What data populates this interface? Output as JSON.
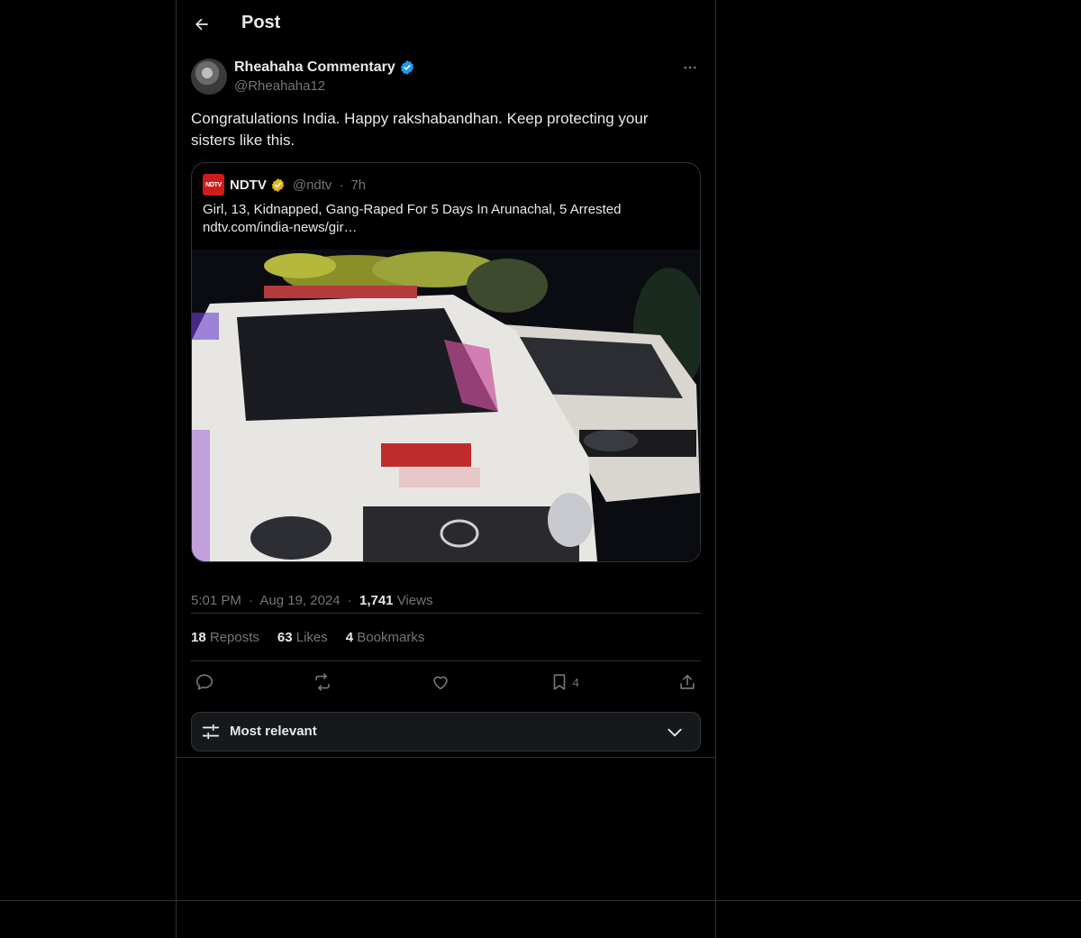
{
  "header": {
    "title": "Post"
  },
  "post": {
    "author": {
      "display_name": "Rheahaha Commentary",
      "handle": "@Rheahaha12"
    },
    "text": "Congratulations India. Happy rakshabandhan. Keep protecting your sisters like this.",
    "quoted": {
      "logo_text": "NDTV",
      "name": "NDTV",
      "handle": "@ndtv",
      "separator": "·",
      "age": "7h",
      "headline": "Girl, 13, Kidnapped, Gang-Raped For 5 Days In Arunachal, 5 Arrested",
      "link": "ndtv.com/india-news/gir…"
    },
    "meta": {
      "time": "5:01 PM",
      "date": "Aug 19, 2024",
      "dot": "·",
      "views_count": "1,741",
      "views_label": "Views"
    },
    "stats": {
      "reposts_count": "18",
      "reposts_label": "Reposts",
      "likes_count": "63",
      "likes_label": "Likes",
      "bookmarks_count": "4",
      "bookmarks_label": "Bookmarks"
    },
    "actions": {
      "bookmark_count": "4"
    }
  },
  "replies": {
    "sort_label": "Most relevant"
  },
  "colors": {
    "background": "#000000",
    "border": "#2f3336",
    "muted": "#71767b",
    "text": "#e7e9ea",
    "verified_blue": "#1d9bf0",
    "verified_gold": "#e2b719",
    "ndtv_red": "#d01b1b"
  },
  "icons": [
    "back-arrow-icon",
    "verified-badge-icon",
    "more-dots-icon",
    "reply-icon",
    "repost-icon",
    "like-icon",
    "bookmark-icon",
    "share-icon",
    "sort-sliders-icon",
    "chevron-down-icon"
  ]
}
